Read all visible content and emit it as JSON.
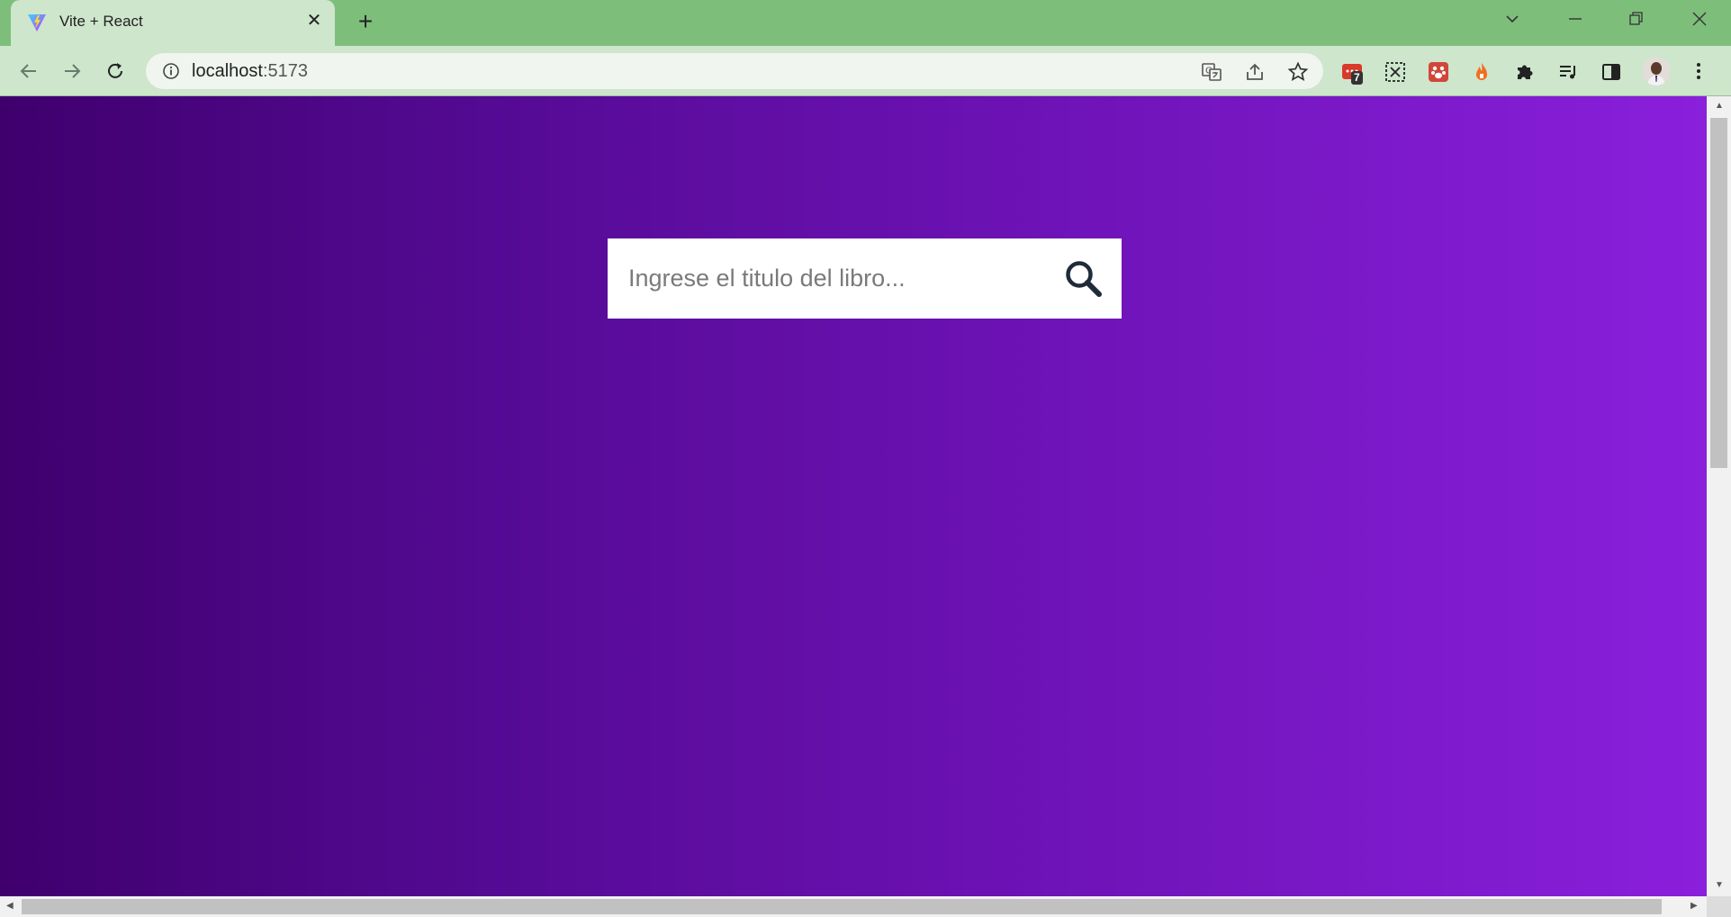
{
  "browser": {
    "tab": {
      "title": "Vite + React",
      "favicon": "vite-logo-icon",
      "close_glyph": "✕"
    },
    "new_tab_glyph": "+",
    "window_controls": [
      "chevron-down-icon",
      "minimize-icon",
      "restore-icon",
      "close-icon"
    ],
    "address_bar": {
      "host": "localhost",
      "port": ":5173"
    },
    "omnibox_icons": [
      "translate-icon",
      "share-icon",
      "star-icon"
    ],
    "extensions": [
      {
        "name": "ext-red-icon",
        "badge": "7"
      },
      {
        "name": "ext-screenshot-icon"
      },
      {
        "name": "ext-paw-icon"
      },
      {
        "name": "ext-flame-icon"
      },
      {
        "name": "puzzle-icon"
      },
      {
        "name": "media-queue-icon"
      },
      {
        "name": "side-panel-icon"
      }
    ],
    "colors": {
      "tabstrip": "#7dbe7b",
      "toolbar": "#cde6cc"
    }
  },
  "page": {
    "search": {
      "placeholder": "Ingrese el titulo del libro...",
      "value": ""
    },
    "colors": {
      "gradient_start": "#3f006d",
      "gradient_end": "#8a1fdc",
      "search_icon": "#1f2b3a"
    }
  }
}
